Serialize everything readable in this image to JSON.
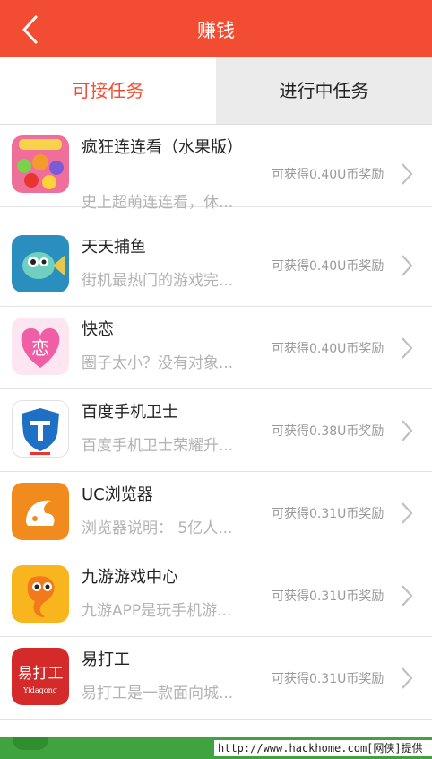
{
  "header": {
    "title": "赚钱"
  },
  "tabs": [
    {
      "label": "可接任务",
      "active": true
    },
    {
      "label": "进行中任务",
      "active": false
    }
  ],
  "tasks": [
    {
      "name": "疯狂连连看（水果版）",
      "description": "史上超萌连连看，休...",
      "reward": "可获得0.40U币奖励",
      "icon": "fruit-link-game-icon"
    },
    {
      "name": "天天捕鱼",
      "description": "街机最热门的游戏完...",
      "reward": "可获得0.40U币奖励",
      "icon": "fish-game-icon"
    },
    {
      "name": "快恋",
      "description": "圈子太小？没有对象...",
      "reward": "可获得0.40U币奖励",
      "icon": "heart-love-icon",
      "icon_text": "恋"
    },
    {
      "name": "百度手机卫士",
      "description": "百度手机卫士荣耀升...",
      "reward": "可获得0.38U币奖励",
      "icon": "shield-guard-icon"
    },
    {
      "name": "UC浏览器",
      "description": "浏览器说明： 5亿人...",
      "reward": "可获得0.31U币奖励",
      "icon": "uc-squirrel-icon"
    },
    {
      "name": "九游游戏中心",
      "description": "九游APP是玩手机游...",
      "reward": "可获得0.31U币奖励",
      "icon": "nine-game-mascot-icon"
    },
    {
      "name": "易打工",
      "description": "易打工是一款面向城...",
      "reward": "可获得0.31U币奖励",
      "icon": "yidagong-icon",
      "icon_text": "易打工",
      "icon_subtext": "Yidagong"
    }
  ],
  "watermark": "http://www.hackhome.com[网侠]提供",
  "colors": {
    "brand": "#f24d33",
    "muted": "#b3b3b3",
    "bottom_bar": "#3fa33f"
  }
}
